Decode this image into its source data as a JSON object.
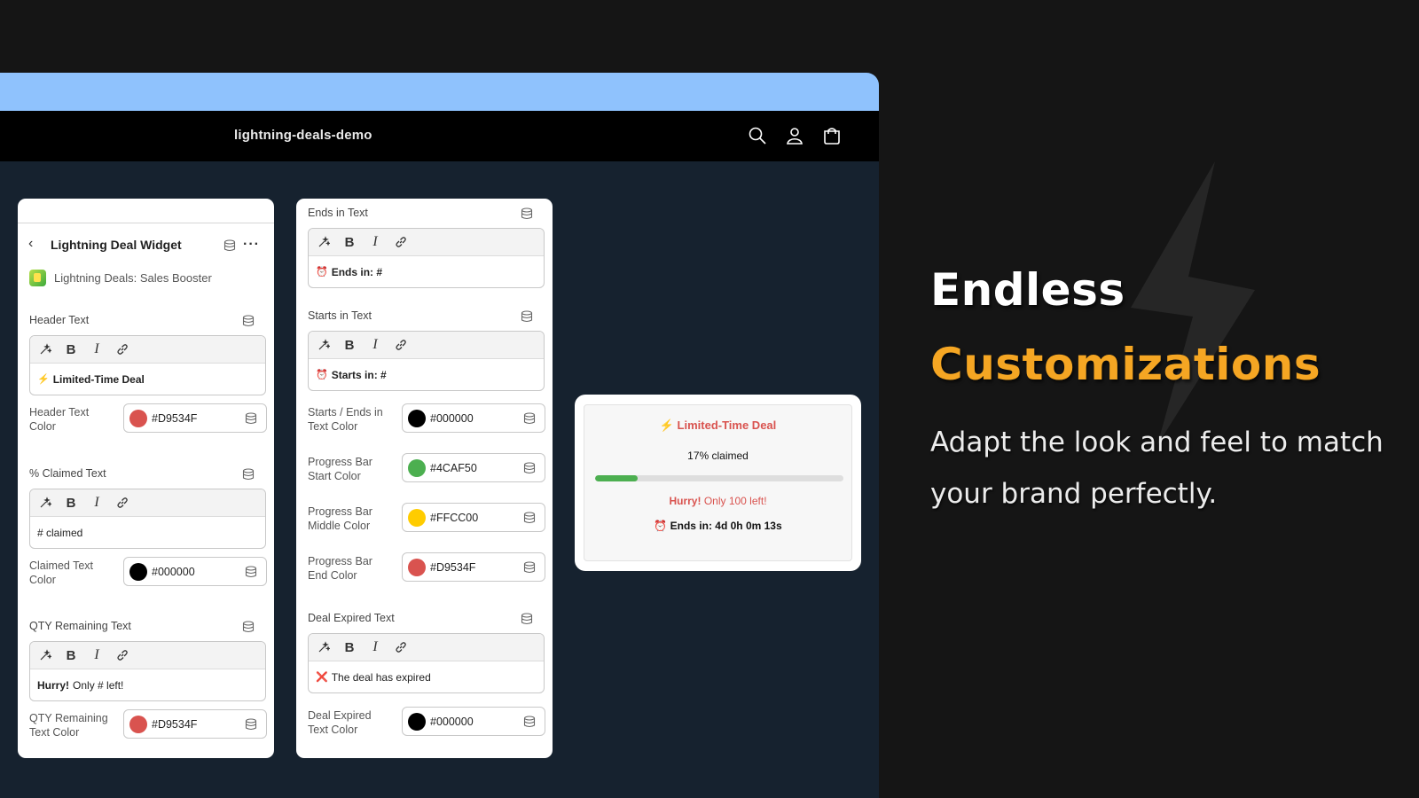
{
  "store": {
    "name": "lightning-deals-demo",
    "icons": [
      "search-icon",
      "account-icon",
      "cart-icon"
    ]
  },
  "widget": {
    "title": "Lightning Deal Widget",
    "app_name": "Lightning Deals: Sales Booster"
  },
  "left_panel": {
    "header_text": {
      "label": "Header Text",
      "emoji": "⚡",
      "bold": "Limited-Time Deal",
      "rest": ""
    },
    "header_color": {
      "label": "Header Text Color",
      "hex": "#D9534F",
      "swatch": "#d9534f"
    },
    "claimed_text": {
      "label": "% Claimed Text",
      "emoji": "",
      "bold": "",
      "rest": "# claimed"
    },
    "claimed_color": {
      "label": "Claimed Text Color",
      "hex": "#000000",
      "swatch": "#000000"
    },
    "qty_text": {
      "label": "QTY Remaining Text",
      "emoji": "",
      "bold": "Hurry!",
      "rest": "Only # left!"
    },
    "qty_color": {
      "label": "QTY Remaining Text Color",
      "hex": "#D9534F",
      "swatch": "#d9534f"
    }
  },
  "right_panel": {
    "ends_text": {
      "label": "Ends in Text",
      "emoji": "⏰",
      "bold": "Ends in: #",
      "rest": ""
    },
    "starts_text": {
      "label": "Starts in Text",
      "emoji": "⏰",
      "bold": "Starts in: #",
      "rest": ""
    },
    "starts_ends_color": {
      "label": "Starts / Ends in Text Color",
      "hex": "#000000",
      "swatch": "#000000"
    },
    "bar_start": {
      "label": "Progress Bar Start Color",
      "hex": "#4CAF50",
      "swatch": "#4caf50"
    },
    "bar_middle": {
      "label": "Progress Bar Middle Color",
      "hex": "#FFCC00",
      "swatch": "#ffcc00"
    },
    "bar_end": {
      "label": "Progress Bar End Color",
      "hex": "#D9534F",
      "swatch": "#d9534f"
    },
    "expired_text": {
      "label": "Deal Expired Text",
      "emoji": "❌",
      "bold": "",
      "rest": "The deal has expired"
    },
    "expired_color": {
      "label": "Deal Expired Text Color",
      "hex": "#000000",
      "swatch": "#000000"
    }
  },
  "preview": {
    "title": "⚡ Limited-Time Deal",
    "claimed": "17% claimed",
    "claimed_fraction": 0.17,
    "hurry_bold": "Hurry!",
    "hurry_rest": " Only 100 left!",
    "ends": "⏰ Ends in: 4d 0h 0m 13s"
  },
  "hero": {
    "line1": "Endless",
    "line2": "Customizations",
    "subtitle": "Adapt the look and feel to match your brand perfectly."
  },
  "colors": {
    "accent": "#f5a623",
    "browser_bar": "#8fc2fd",
    "red": "#d9534f",
    "green": "#4caf50"
  }
}
